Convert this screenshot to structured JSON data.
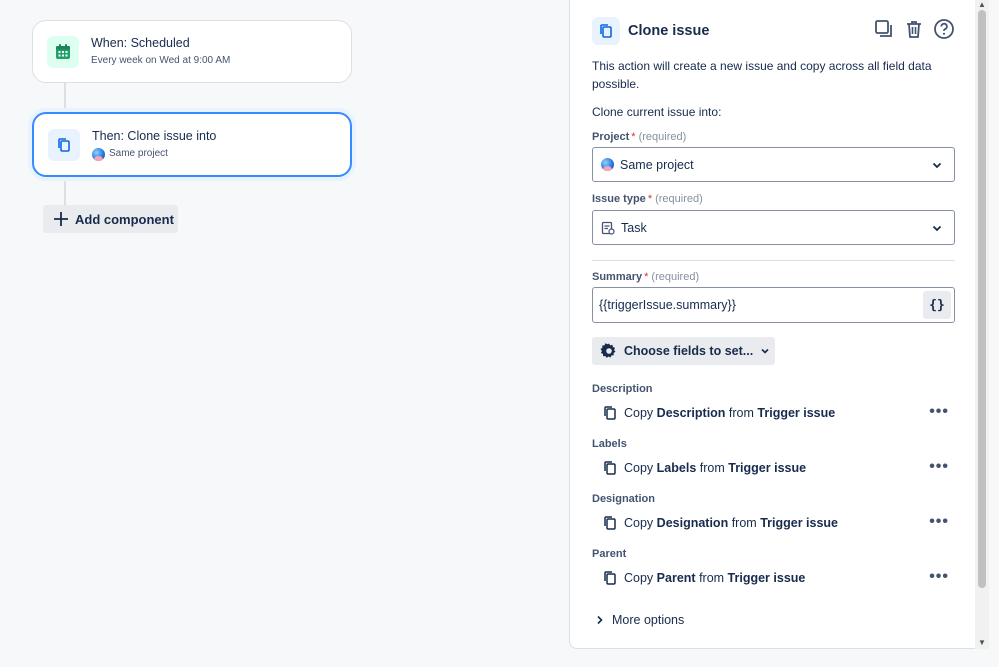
{
  "canvas": {
    "trigger": {
      "title": "When: Scheduled",
      "subtitle": "Every week on Wed at 9:00 AM",
      "icon": "calendar-icon"
    },
    "action": {
      "title": "Then: Clone issue into",
      "subtitle": "Same project",
      "icon": "clone-icon"
    },
    "add_component_label": "Add component"
  },
  "panel": {
    "title": "Clone issue",
    "description": "This action will create a new issue and copy across all field data possible.",
    "clone_into_label": "Clone current issue into:",
    "project": {
      "label": "Project",
      "star": "*",
      "required": "(required)",
      "value": "Same project"
    },
    "issue_type": {
      "label": "Issue type",
      "star": "*",
      "required": "(required)",
      "value": "Task"
    },
    "summary": {
      "label": "Summary",
      "star": "*",
      "required": "(required)",
      "value": "{{triggerIssue.summary}}",
      "smart_value_button": "{}"
    },
    "choose_fields_label": "Choose fields to set...",
    "fields": [
      {
        "label": "Description",
        "copy": "Copy",
        "field": "Description",
        "from": "from",
        "source": "Trigger issue"
      },
      {
        "label": "Labels",
        "copy": "Copy",
        "field": "Labels",
        "from": "from",
        "source": "Trigger issue"
      },
      {
        "label": "Designation",
        "copy": "Copy",
        "field": "Designation",
        "from": "from",
        "source": "Trigger issue"
      },
      {
        "label": "Parent",
        "copy": "Copy",
        "field": "Parent",
        "from": "from",
        "source": "Trigger issue"
      }
    ],
    "more_options_label": "More options"
  },
  "colors": {
    "accent": "#388bff",
    "trigger_icon_bg": "#dcfff1",
    "action_icon_bg": "#e9f2ff",
    "required_star": "#c9372c"
  }
}
